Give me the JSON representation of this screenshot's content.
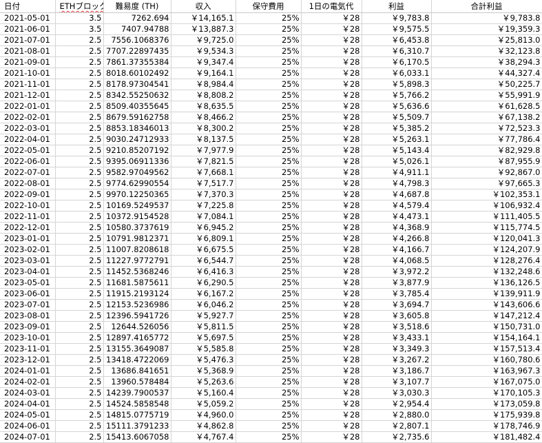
{
  "headers": [
    "日付",
    "ETHブロック報酬",
    "難易度 (TH)",
    "収入",
    "保守費用",
    "1日の電気代",
    "利益",
    "合計利益"
  ],
  "rows": [
    [
      "2021-05-01",
      "3.5",
      "7262.694",
      "￥14,165.1",
      "25%",
      "￥28",
      "￥9,783.8",
      "￥9,783.8"
    ],
    [
      "2021-06-01",
      "3.5",
      "7407.94788",
      "￥13,887.3",
      "25%",
      "￥28",
      "￥9,575.5",
      "￥19,359.3"
    ],
    [
      "2021-07-01",
      "2.5",
      "7556.1068376",
      "￥9,725.0",
      "25%",
      "￥28",
      "￥6,453.8",
      "￥25,813.0"
    ],
    [
      "2021-08-01",
      "2.5",
      "7707.22897435",
      "￥9,534.3",
      "25%",
      "￥28",
      "￥6,310.7",
      "￥32,123.8"
    ],
    [
      "2021-09-01",
      "2.5",
      "7861.37355384",
      "￥9,347.4",
      "25%",
      "￥28",
      "￥6,170.5",
      "￥38,294.3"
    ],
    [
      "2021-10-01",
      "2.5",
      "8018.60102492",
      "￥9,164.1",
      "25%",
      "￥28",
      "￥6,033.1",
      "￥44,327.4"
    ],
    [
      "2021-11-01",
      "2.5",
      "8178.97304541",
      "￥8,984.4",
      "25%",
      "￥28",
      "￥5,898.3",
      "￥50,225.7"
    ],
    [
      "2021-12-01",
      "2.5",
      "8342.55250632",
      "￥8,808.2",
      "25%",
      "￥28",
      "￥5,766.2",
      "￥55,991.9"
    ],
    [
      "2022-01-01",
      "2.5",
      "8509.40355645",
      "￥8,635.5",
      "25%",
      "￥28",
      "￥5,636.6",
      "￥61,628.5"
    ],
    [
      "2022-02-01",
      "2.5",
      "8679.59162758",
      "￥8,466.2",
      "25%",
      "￥28",
      "￥5,509.7",
      "￥67,138.2"
    ],
    [
      "2022-03-01",
      "2.5",
      "8853.18346013",
      "￥8,300.2",
      "25%",
      "￥28",
      "￥5,385.2",
      "￥72,523.3"
    ],
    [
      "2022-04-01",
      "2.5",
      "9030.24712933",
      "￥8,137.5",
      "25%",
      "￥28",
      "￥5,263.1",
      "￥77,786.4"
    ],
    [
      "2022-05-01",
      "2.5",
      "9210.85207192",
      "￥7,977.9",
      "25%",
      "￥28",
      "￥5,143.4",
      "￥82,929.8"
    ],
    [
      "2022-06-01",
      "2.5",
      "9395.06911336",
      "￥7,821.5",
      "25%",
      "￥28",
      "￥5,026.1",
      "￥87,955.9"
    ],
    [
      "2022-07-01",
      "2.5",
      "9582.97049562",
      "￥7,668.1",
      "25%",
      "￥28",
      "￥4,911.1",
      "￥92,867.0"
    ],
    [
      "2022-08-01",
      "2.5",
      "9774.62990554",
      "￥7,517.7",
      "25%",
      "￥28",
      "￥4,798.3",
      "￥97,665.3"
    ],
    [
      "2022-09-01",
      "2.5",
      "9970.12250365",
      "￥7,370.3",
      "25%",
      "￥28",
      "￥4,687.8",
      "￥102,353.1"
    ],
    [
      "2022-10-01",
      "2.5",
      "10169.5249537",
      "￥7,225.8",
      "25%",
      "￥28",
      "￥4,579.4",
      "￥106,932.4"
    ],
    [
      "2022-11-01",
      "2.5",
      "10372.9154528",
      "￥7,084.1",
      "25%",
      "￥28",
      "￥4,473.1",
      "￥111,405.5"
    ],
    [
      "2022-12-01",
      "2.5",
      "10580.3737619",
      "￥6,945.2",
      "25%",
      "￥28",
      "￥4,368.9",
      "￥115,774.5"
    ],
    [
      "2023-01-01",
      "2.5",
      "10791.9812371",
      "￥6,809.1",
      "25%",
      "￥28",
      "￥4,266.8",
      "￥120,041.3"
    ],
    [
      "2023-02-01",
      "2.5",
      "11007.8208618",
      "￥6,675.5",
      "25%",
      "￥28",
      "￥4,166.7",
      "￥124,207.9"
    ],
    [
      "2023-03-01",
      "2.5",
      "11227.9772791",
      "￥6,544.7",
      "25%",
      "￥28",
      "￥4,068.5",
      "￥128,276.4"
    ],
    [
      "2023-04-01",
      "2.5",
      "11452.5368246",
      "￥6,416.3",
      "25%",
      "￥28",
      "￥3,972.2",
      "￥132,248.6"
    ],
    [
      "2023-05-01",
      "2.5",
      "11681.5875611",
      "￥6,290.5",
      "25%",
      "￥28",
      "￥3,877.9",
      "￥136,126.5"
    ],
    [
      "2023-06-01",
      "2.5",
      "11915.2193124",
      "￥6,167.2",
      "25%",
      "￥28",
      "￥3,785.4",
      "￥139,911.9"
    ],
    [
      "2023-07-01",
      "2.5",
      "12153.5236986",
      "￥6,046.2",
      "25%",
      "￥28",
      "￥3,694.7",
      "￥143,606.6"
    ],
    [
      "2023-08-01",
      "2.5",
      "12396.5941726",
      "￥5,927.7",
      "25%",
      "￥28",
      "￥3,605.8",
      "￥147,212.4"
    ],
    [
      "2023-09-01",
      "2.5",
      "12644.526056",
      "￥5,811.5",
      "25%",
      "￥28",
      "￥3,518.6",
      "￥150,731.0"
    ],
    [
      "2023-10-01",
      "2.5",
      "12897.4165772",
      "￥5,697.5",
      "25%",
      "￥28",
      "￥3,433.1",
      "￥154,164.1"
    ],
    [
      "2023-11-01",
      "2.5",
      "13155.3649087",
      "￥5,585.8",
      "25%",
      "￥28",
      "￥3,349.3",
      "￥157,513.4"
    ],
    [
      "2023-12-01",
      "2.5",
      "13418.4722069",
      "￥5,476.3",
      "25%",
      "￥28",
      "￥3,267.2",
      "￥160,780.6"
    ],
    [
      "2024-01-01",
      "2.5",
      "13686.841651",
      "￥5,368.9",
      "25%",
      "￥28",
      "￥3,186.7",
      "￥163,967.3"
    ],
    [
      "2024-02-01",
      "2.5",
      "13960.578484",
      "￥5,263.6",
      "25%",
      "￥28",
      "￥3,107.7",
      "￥167,075.0"
    ],
    [
      "2024-03-01",
      "2.5",
      "14239.7900537",
      "￥5,160.4",
      "25%",
      "￥28",
      "￥3,030.3",
      "￥170,105.3"
    ],
    [
      "2024-04-01",
      "2.5",
      "14524.5858548",
      "￥5,059.2",
      "25%",
      "￥28",
      "￥2,954.4",
      "￥173,059.8"
    ],
    [
      "2024-05-01",
      "2.5",
      "14815.0775719",
      "￥4,960.0",
      "25%",
      "￥28",
      "￥2,880.0",
      "￥175,939.8"
    ],
    [
      "2024-06-01",
      "2.5",
      "15111.3791233",
      "￥4,862.8",
      "25%",
      "￥28",
      "￥2,807.1",
      "￥178,746.9"
    ],
    [
      "2024-07-01",
      "2.5",
      "15413.6067058",
      "￥4,767.4",
      "25%",
      "￥28",
      "￥2,735.6",
      "￥181,482.4"
    ]
  ]
}
